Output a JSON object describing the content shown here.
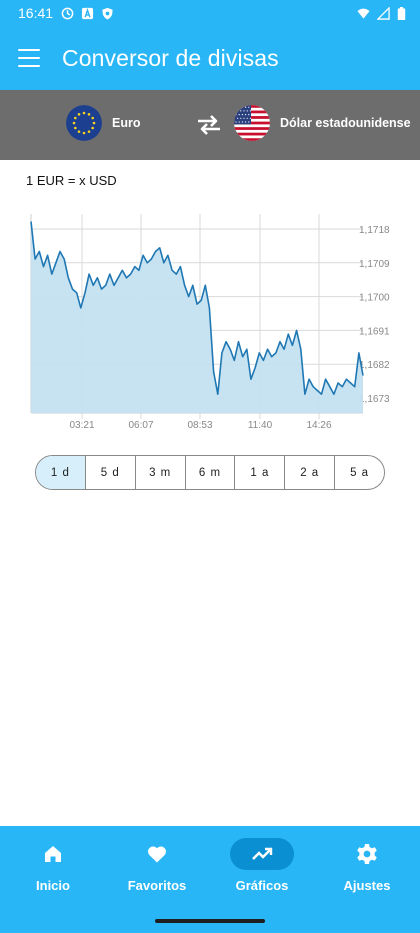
{
  "status_bar": {
    "time": "16:41"
  },
  "app_bar": {
    "title": "Conversor de divisas"
  },
  "currency": {
    "from": {
      "label": "Euro"
    },
    "to": {
      "label": "Dólar estadounidense"
    }
  },
  "rate_label": "1 EUR = x USD",
  "colors": {
    "primary": "#29b6f6",
    "selector_bg": "#6d6d6d",
    "line": "#1f78b4",
    "fill": "#c4e0ef",
    "nav_active": "#0b8fd3"
  },
  "chart_data": {
    "type": "area",
    "x_ticks": [
      "03:21",
      "06:07",
      "08:53",
      "11:40",
      "14:26"
    ],
    "y_ticks": [
      "1,1718",
      "1,1709",
      "1,1700",
      "1,1691",
      "1,1682",
      "1,1673"
    ],
    "ylim": [
      1.1669,
      1.1722
    ],
    "series": [
      {
        "values": [
          1.172,
          1.171,
          1.1712,
          1.1708,
          1.1711,
          1.1706,
          1.1709,
          1.1712,
          1.171,
          1.1705,
          1.1702,
          1.1701,
          1.1697,
          1.1701,
          1.1706,
          1.1703,
          1.1705,
          1.1702,
          1.1703,
          1.1706,
          1.1703,
          1.1705,
          1.1707,
          1.1705,
          1.1706,
          1.1708,
          1.1707,
          1.1711,
          1.1709,
          1.171,
          1.1712,
          1.1713,
          1.1709,
          1.1711,
          1.1707,
          1.1706,
          1.1708,
          1.1703,
          1.17,
          1.1703,
          1.1698,
          1.1699,
          1.1703,
          1.1697,
          1.168,
          1.1674,
          1.1685,
          1.1688,
          1.1686,
          1.1683,
          1.1688,
          1.1684,
          1.1686,
          1.1678,
          1.1681,
          1.1685,
          1.1683,
          1.1686,
          1.1684,
          1.1685,
          1.1688,
          1.1686,
          1.169,
          1.1687,
          1.1691,
          1.1686,
          1.1674,
          1.1678,
          1.1676,
          1.1675,
          1.1674,
          1.1678,
          1.1676,
          1.1674,
          1.1677,
          1.1676,
          1.1678,
          1.1677,
          1.1676,
          1.1685,
          1.1679
        ]
      }
    ],
    "grid": true,
    "legend": "none"
  },
  "range_selector": {
    "options": [
      "1 d",
      "5 d",
      "3 m",
      "6 m",
      "1 a",
      "2 a",
      "5 a"
    ],
    "selected": "1 d"
  },
  "bottom_nav": [
    {
      "label": "Inicio",
      "icon": "home-icon"
    },
    {
      "label": "Favoritos",
      "icon": "heart-icon"
    },
    {
      "label": "Gráficos",
      "icon": "trending-up-icon",
      "active": true
    },
    {
      "label": "Ajustes",
      "icon": "gear-icon"
    }
  ]
}
